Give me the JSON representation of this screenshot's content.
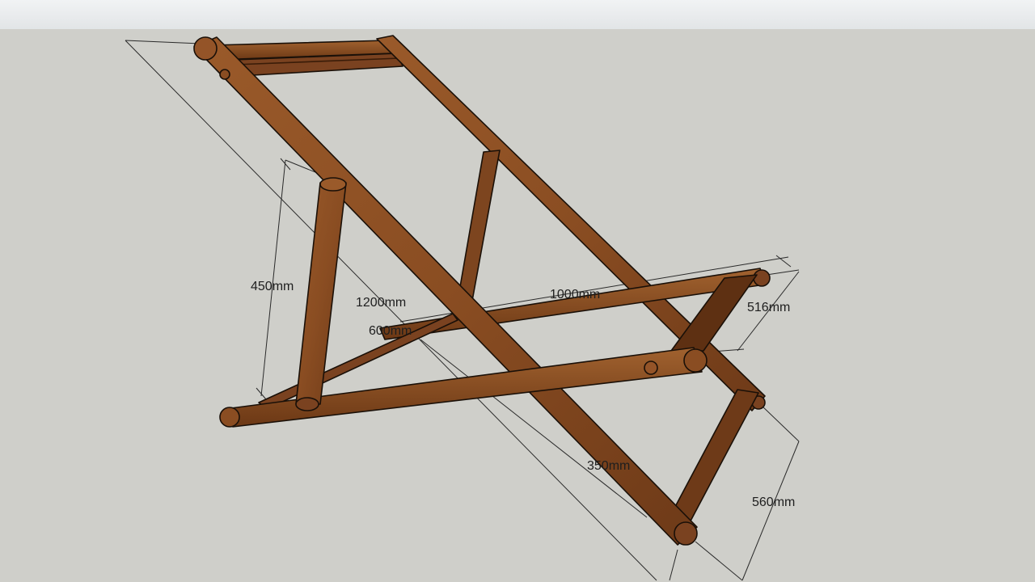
{
  "viewport": {
    "sky_color": "#e8eaec",
    "ground_color": "#cfcfca"
  },
  "model": {
    "subject": "deck chair frame",
    "wood_color": "#8a4f24",
    "outline_color": "#1a1008"
  },
  "dimensions": {
    "d1200": "1200mm",
    "d450": "450mm",
    "d1000": "1000mm",
    "d516": "516mm",
    "d600": "600mm",
    "d350": "350mm",
    "d560": "560mm"
  }
}
